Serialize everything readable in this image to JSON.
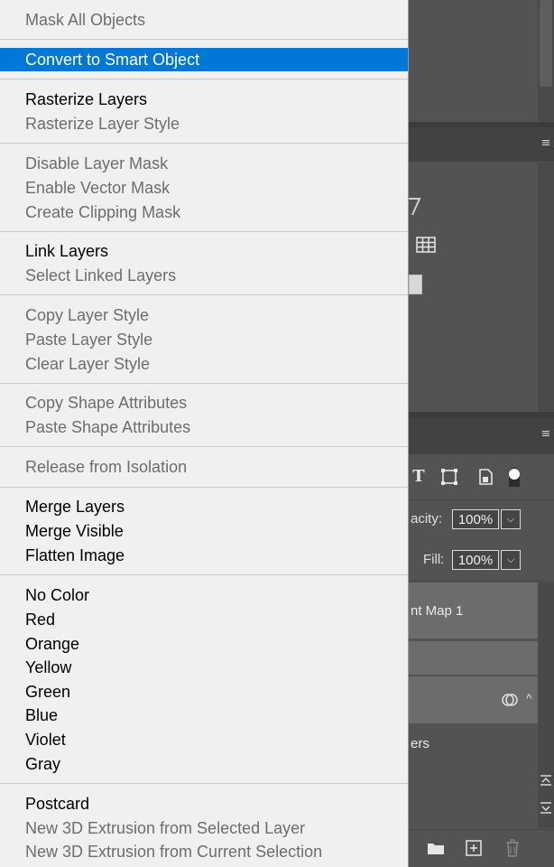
{
  "menu": {
    "items": [
      {
        "label": "Mask All Objects",
        "enabled": false
      },
      {
        "label": "Convert to Smart Object",
        "enabled": true,
        "highlighted": true
      },
      {
        "label": "Rasterize Layers",
        "enabled": true
      },
      {
        "label": "Rasterize Layer Style",
        "enabled": false
      },
      {
        "label": "Disable Layer Mask",
        "enabled": false
      },
      {
        "label": "Enable Vector Mask",
        "enabled": false
      },
      {
        "label": "Create Clipping Mask",
        "enabled": false
      },
      {
        "label": "Link Layers",
        "enabled": true
      },
      {
        "label": "Select Linked Layers",
        "enabled": false
      },
      {
        "label": "Copy Layer Style",
        "enabled": false
      },
      {
        "label": "Paste Layer Style",
        "enabled": false
      },
      {
        "label": "Clear Layer Style",
        "enabled": false
      },
      {
        "label": "Copy Shape Attributes",
        "enabled": false
      },
      {
        "label": "Paste Shape Attributes",
        "enabled": false
      },
      {
        "label": "Release from Isolation",
        "enabled": false
      },
      {
        "label": "Merge Layers",
        "enabled": true
      },
      {
        "label": "Merge Visible",
        "enabled": true
      },
      {
        "label": "Flatten Image",
        "enabled": true
      },
      {
        "label": "No Color",
        "enabled": true
      },
      {
        "label": "Red",
        "enabled": true
      },
      {
        "label": "Orange",
        "enabled": true
      },
      {
        "label": "Yellow",
        "enabled": true
      },
      {
        "label": "Green",
        "enabled": true
      },
      {
        "label": "Blue",
        "enabled": true
      },
      {
        "label": "Violet",
        "enabled": true
      },
      {
        "label": "Gray",
        "enabled": true
      },
      {
        "label": "Postcard",
        "enabled": true
      },
      {
        "label": "New 3D Extrusion from Selected Layer",
        "enabled": false
      },
      {
        "label": "New 3D Extrusion from Current Selection",
        "enabled": false
      }
    ]
  },
  "layers_panel": {
    "opacity_label": "acity:",
    "opacity_value": "100%",
    "fill_label": "Fill:",
    "fill_value": "100%",
    "layer_name_partial": "nt Map 1",
    "layer_name_partial_2": "ers",
    "dropdown_glyph": "⌵"
  },
  "icons": {
    "hamburger": "≡",
    "type_tool": "T",
    "transform": "⌑",
    "smart_object": "🗎",
    "folder": "▬",
    "new_layer": "⊞",
    "trash": "🗑",
    "grid": "▦",
    "link": "⚲",
    "collapse": "^"
  },
  "colors": {
    "highlight": "#0078d7",
    "menu_bg": "#f0f0f0",
    "panel_bg": "#535353"
  }
}
